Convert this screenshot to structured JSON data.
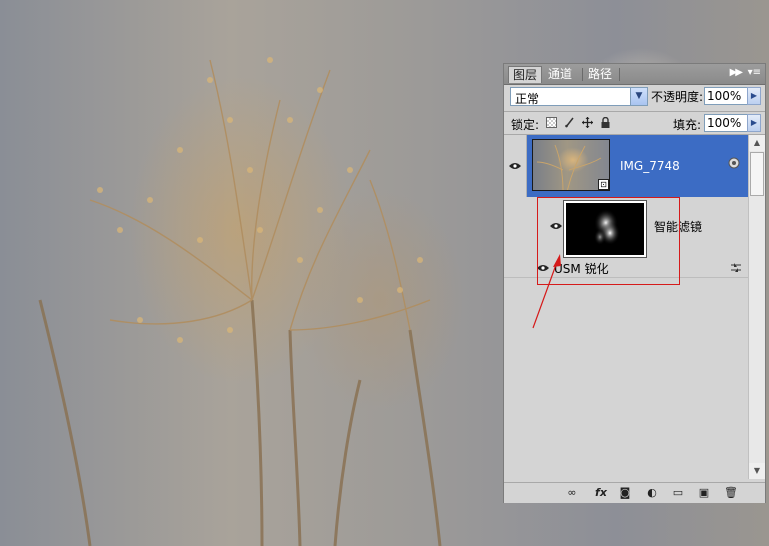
{
  "panel": {
    "tabs": [
      {
        "label": "图层",
        "active": true
      },
      {
        "label": "通道",
        "active": false
      },
      {
        "label": "路径",
        "active": false
      }
    ],
    "collapse_icon": "double-chevron-right-icon",
    "menu_icon": "panel-menu-icon",
    "blend_mode": "正常",
    "opacity_label": "不透明度:",
    "opacity_value": "100%",
    "lock_label": "锁定:",
    "fill_label": "填充:",
    "fill_value": "100%",
    "layers": [
      {
        "name": "IMG_7748",
        "selected": true,
        "type": "smart-object"
      },
      {
        "name": "智能滤镜",
        "type": "smart-filter-mask"
      },
      {
        "name": "USM 锐化",
        "type": "filter"
      }
    ],
    "footer_icons": [
      "link-layers-icon",
      "fx-icon",
      "add-mask-icon",
      "adjustment-layer-icon",
      "group-folder-icon",
      "new-layer-icon",
      "trash-icon"
    ]
  },
  "colors": {
    "selection": "#3c6cc4",
    "panel_bg": "#d4d4d4",
    "annotation": "#d51a1a"
  }
}
